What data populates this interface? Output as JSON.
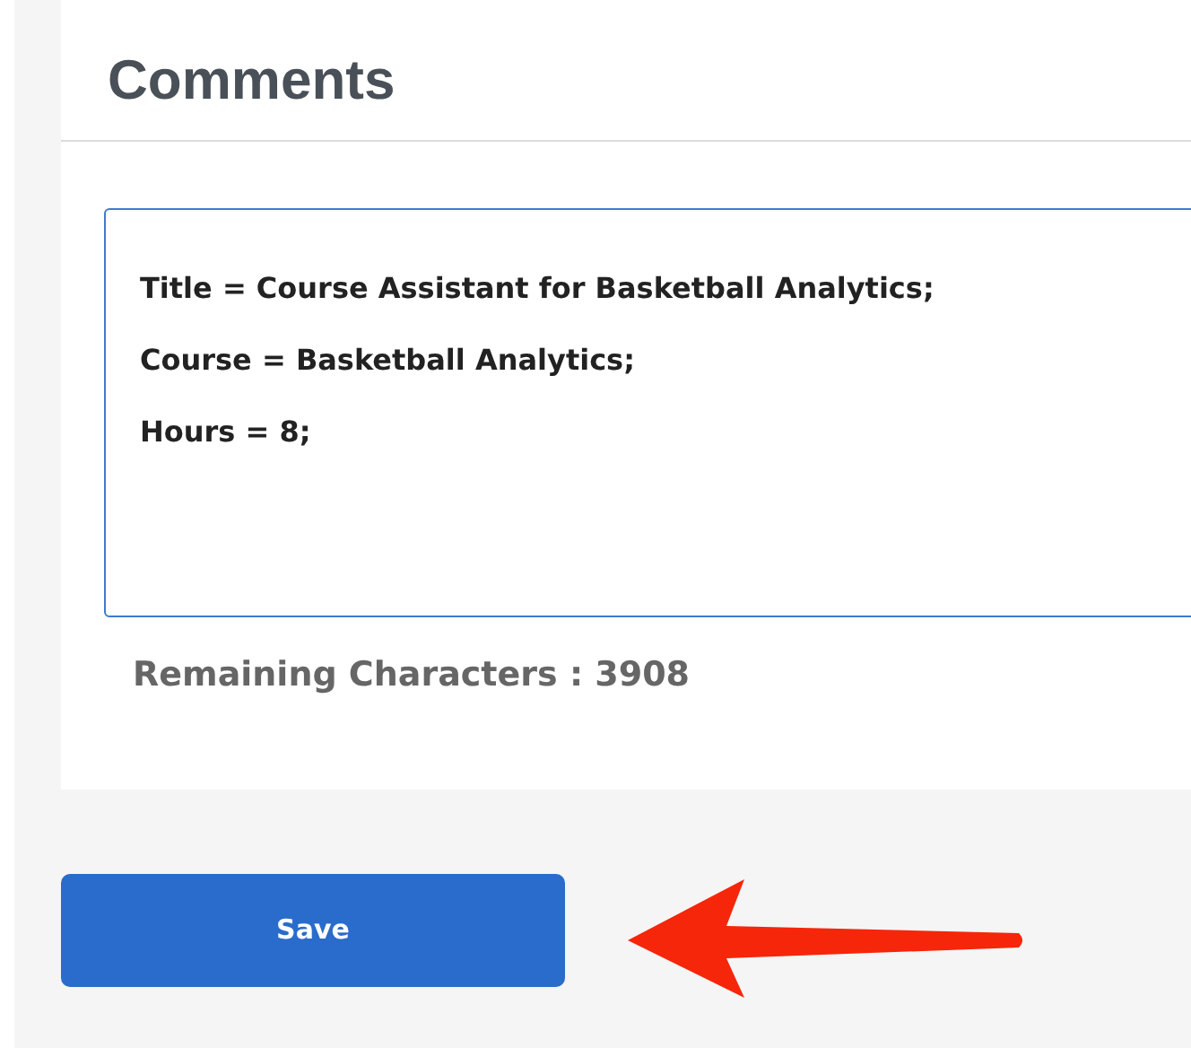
{
  "panel": {
    "title": "Comments"
  },
  "comment_field": {
    "lines": [
      "Title = Course Assistant for Basketball Analytics;",
      "Course = Basketball Analytics;",
      "Hours = 8;"
    ]
  },
  "remaining_characters": "Remaining Characters : 3908",
  "save_button": {
    "label": "Save"
  }
}
